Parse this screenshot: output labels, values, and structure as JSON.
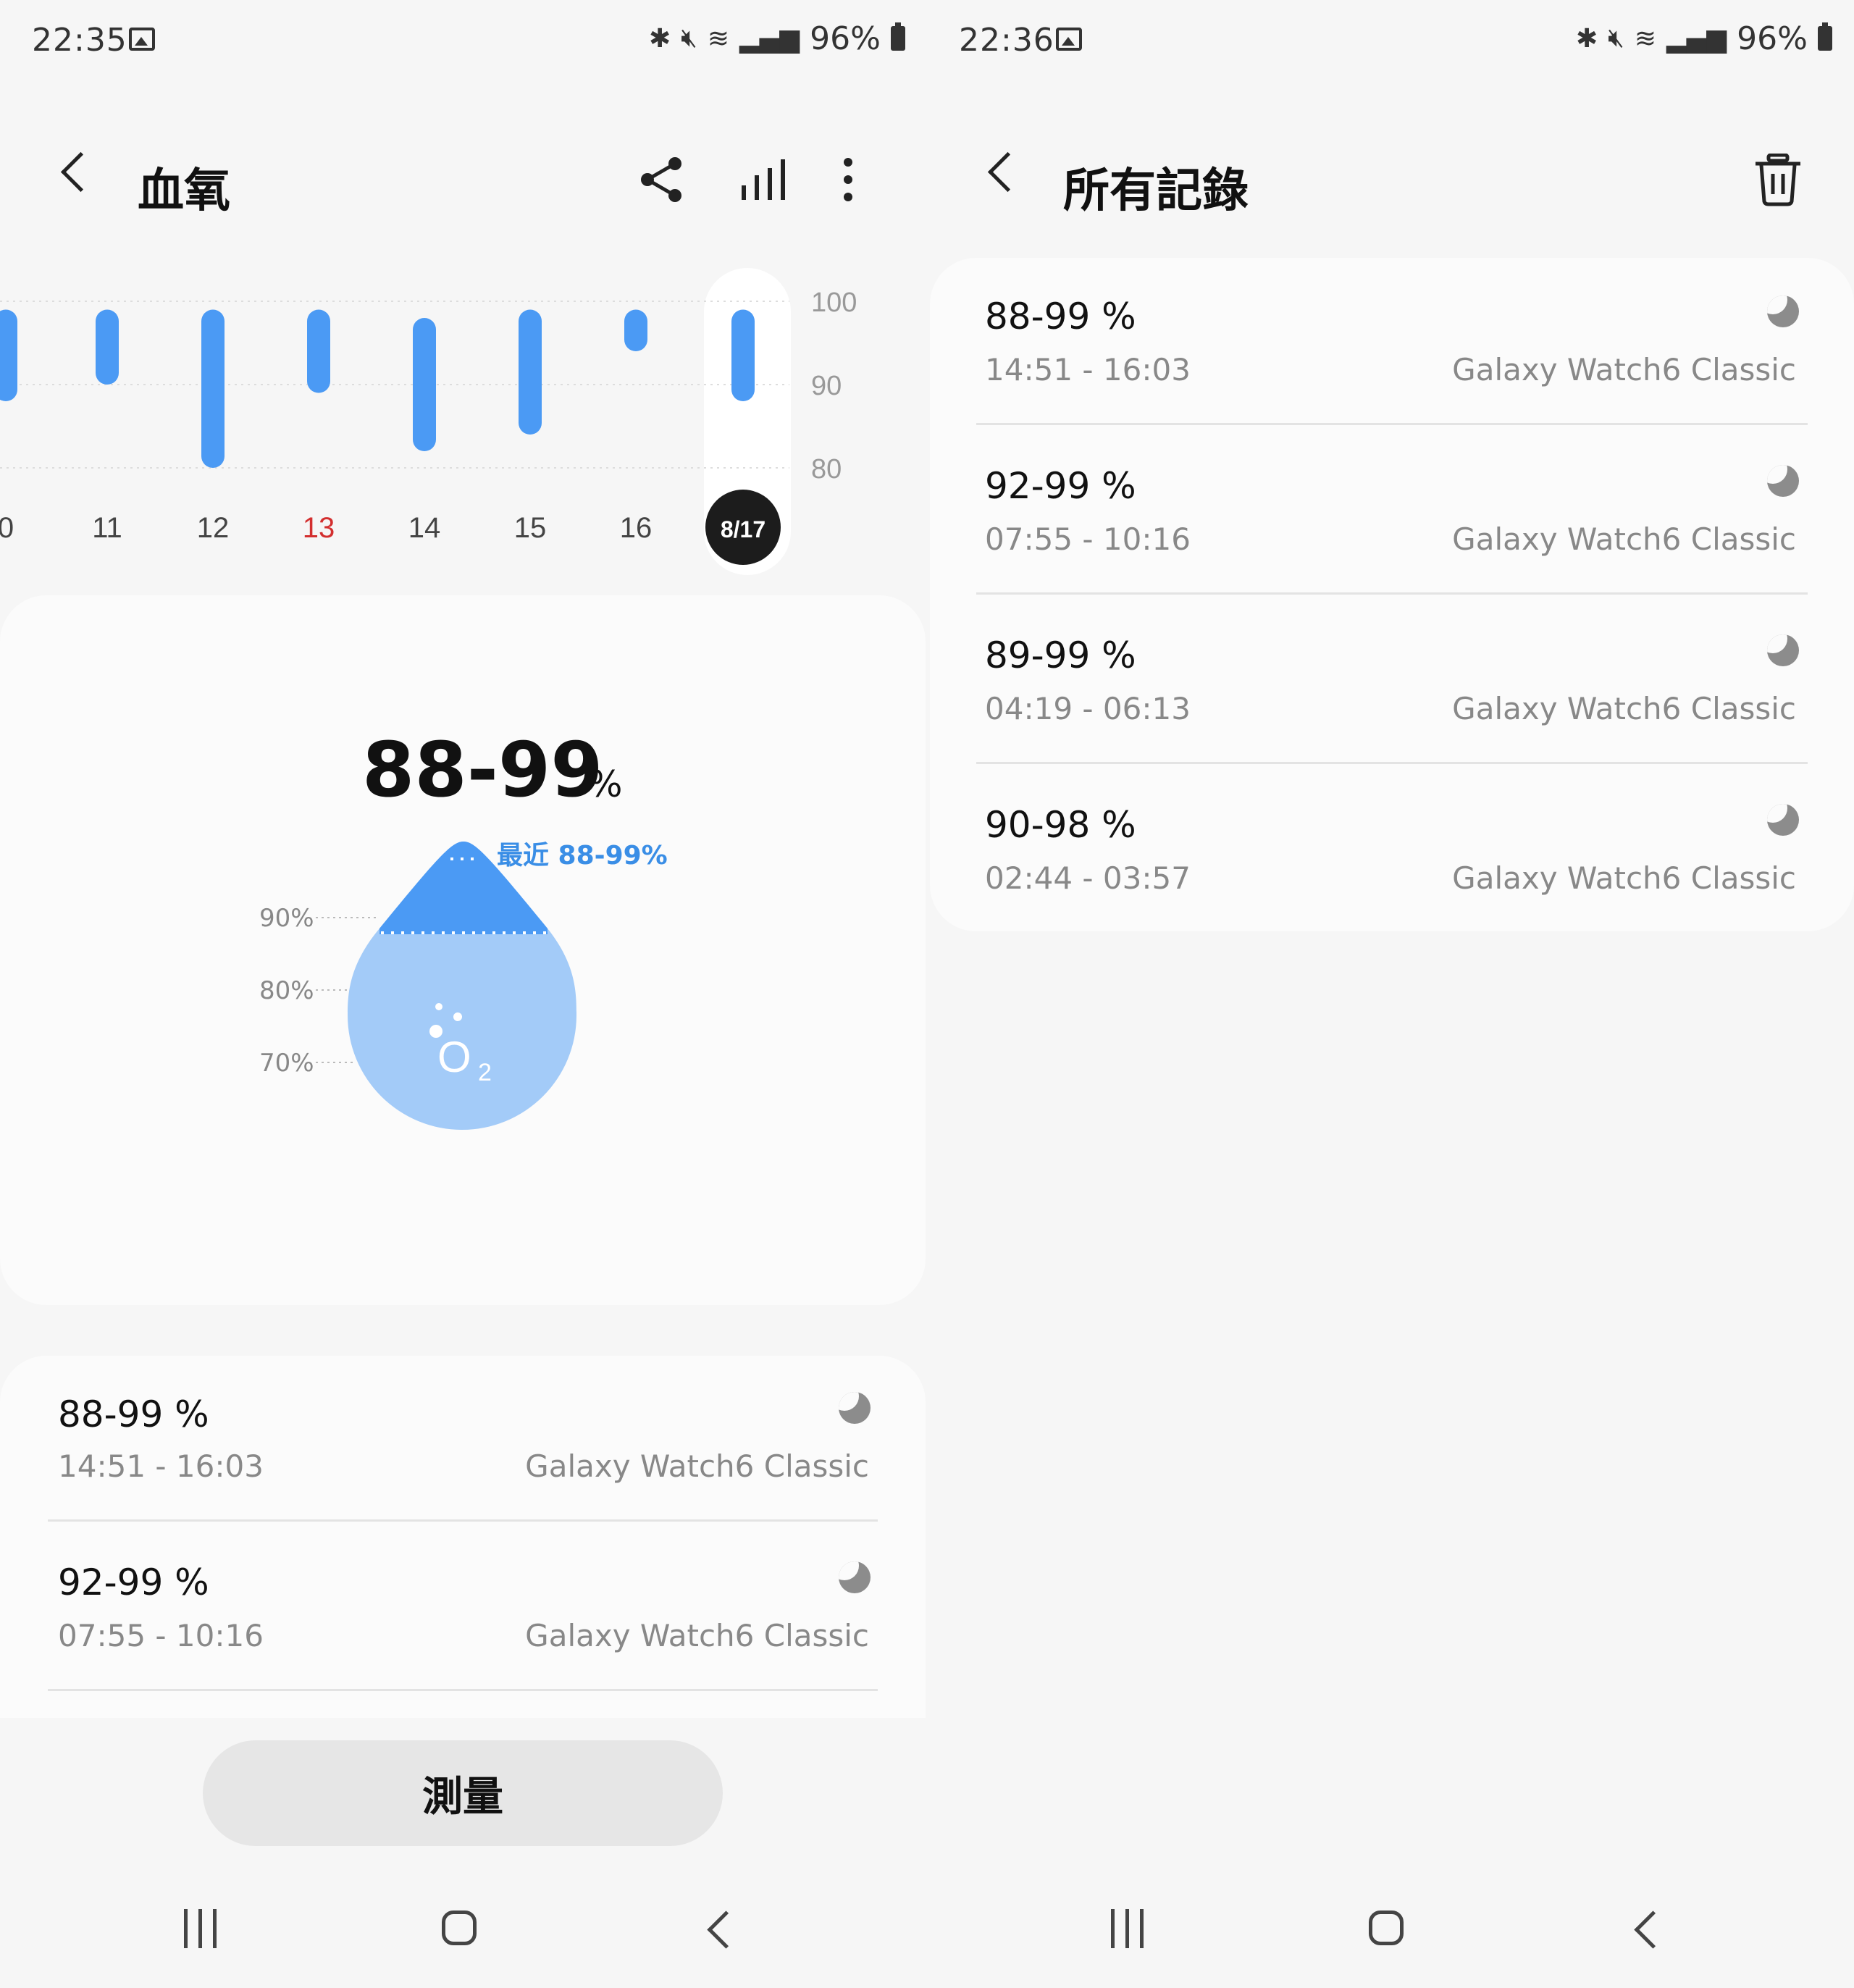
{
  "left": {
    "status_bar": {
      "time": "22:35",
      "battery": "96%"
    },
    "header": {
      "title": "血氧"
    },
    "chart_data": {
      "type": "bar",
      "categories": [
        "0",
        "11",
        "12",
        "13",
        "14",
        "15",
        "16",
        "8/17"
      ],
      "ranges": [
        [
          88,
          99
        ],
        [
          90,
          99
        ],
        [
          80,
          99
        ],
        [
          89,
          99
        ],
        [
          82,
          98
        ],
        [
          84,
          99
        ],
        [
          94,
          99
        ],
        [
          88,
          99
        ]
      ],
      "y_ticks": [
        "100",
        "90",
        "80"
      ],
      "ylim": [
        80,
        100
      ],
      "highlight_category": "13",
      "selected_category": "8/17",
      "bar_color": "#4b9af4",
      "highlight_color": "#d32f2f"
    },
    "summary": {
      "value": "88-99",
      "unit": "%",
      "recent_label": "最近 88-99%",
      "scale": [
        "90%",
        "80%",
        "70%"
      ],
      "o2_label": "O",
      "o2_sub": "2"
    },
    "records": [
      {
        "value": "88-99 %",
        "time": "14:51 - 16:03",
        "device": "Galaxy Watch6 Classic"
      },
      {
        "value": "92-99 %",
        "time": "07:55 - 10:16",
        "device": "Galaxy Watch6 Classic"
      }
    ],
    "measure_button": "測量"
  },
  "right": {
    "status_bar": {
      "time": "22:36",
      "battery": "96%"
    },
    "header": {
      "title": "所有記錄"
    },
    "records": [
      {
        "value": "88-99 %",
        "time": "14:51 - 16:03",
        "device": "Galaxy Watch6 Classic"
      },
      {
        "value": "92-99 %",
        "time": "07:55 - 10:16",
        "device": "Galaxy Watch6 Classic"
      },
      {
        "value": "89-99 %",
        "time": "04:19 - 06:13",
        "device": "Galaxy Watch6 Classic"
      },
      {
        "value": "90-98 %",
        "time": "02:44 - 03:57",
        "device": "Galaxy Watch6 Classic"
      }
    ]
  },
  "icons": {
    "status": [
      "image-icon",
      "bluetooth-icon",
      "mute-icon",
      "wifi-icon",
      "signal-icon",
      "battery-icon"
    ],
    "header_left": [
      "back-icon",
      "share-icon",
      "chart-icon",
      "more-icon"
    ],
    "header_right": [
      "back-icon",
      "trash-icon"
    ],
    "record": "moon-icon",
    "nav": [
      "recent-apps-icon",
      "home-icon",
      "back-icon"
    ]
  }
}
